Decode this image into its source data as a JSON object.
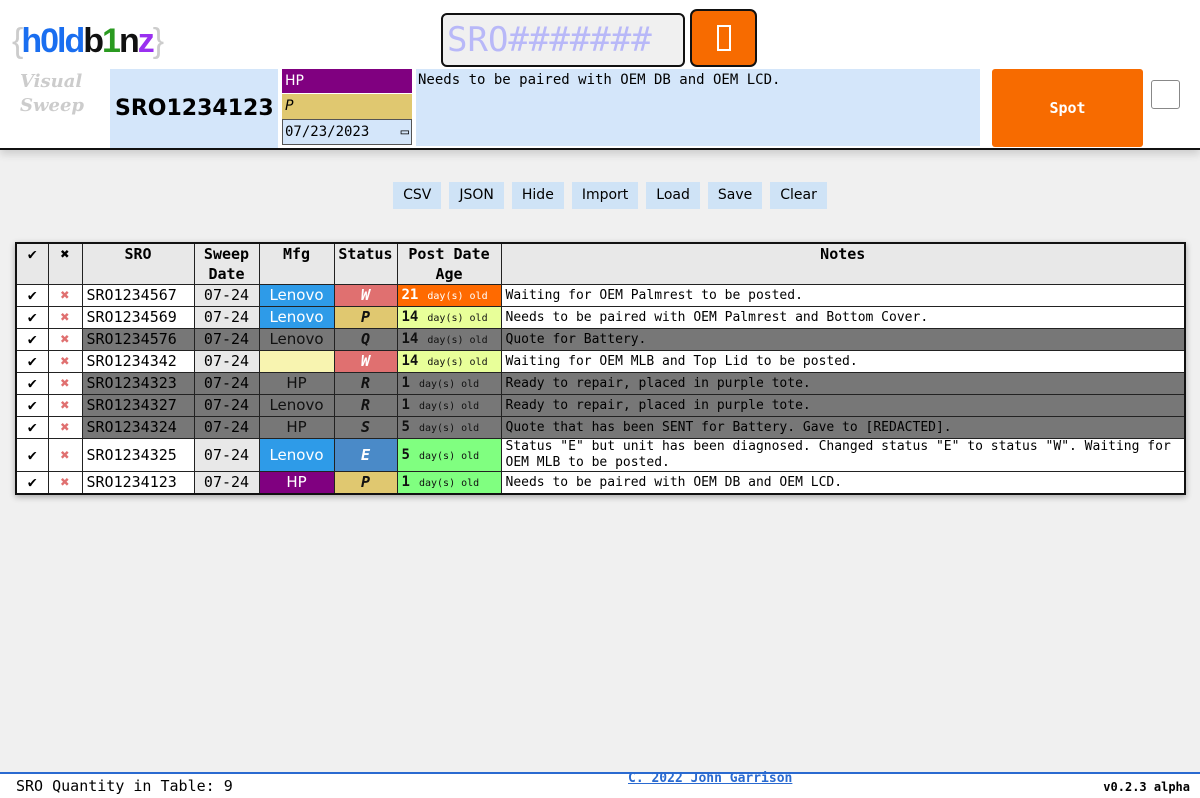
{
  "header": {
    "logo": {
      "brace_open": "{",
      "parts": [
        "h0ld",
        "b",
        "1",
        "n",
        "z"
      ],
      "brace_close": "}"
    },
    "subtitle_line1": "Visual",
    "subtitle_line2": "Sweep",
    "search_placeholder": "SRO#######",
    "search_icon": "box-icon",
    "sro": "SRO1234123",
    "mfg": "HP",
    "status": "P",
    "date": "07/23/2023",
    "notes": "Needs to be paired with OEM DB and OEM LCD.",
    "spot_label": "Spot"
  },
  "toolbar": [
    "CSV",
    "JSON",
    "Hide",
    "Import",
    "Load",
    "Save",
    "Clear"
  ],
  "table": {
    "headers": [
      "✔",
      "✖",
      "SRO",
      "Sweep Date",
      "Mfg",
      "Status",
      "Post Date Age",
      "Notes"
    ],
    "rows": [
      {
        "check": "✔",
        "del": "✖",
        "sro": "SRO1234567",
        "date": "07-24",
        "mfg": "Lenovo",
        "status": "W",
        "age": "21",
        "age_unit": "day(s) old",
        "notes": "Waiting for OEM Palmrest to be posted."
      },
      {
        "check": "✔",
        "del": "✖",
        "sro": "SRO1234569",
        "date": "07-24",
        "mfg": "Lenovo",
        "status": "P",
        "age": "14",
        "age_unit": "day(s) old",
        "notes": "Needs to be paired with OEM Palmrest and Bottom Cover."
      },
      {
        "check": "✔",
        "del": "✖",
        "sro": "SRO1234576",
        "date": "07-24",
        "mfg": "Lenovo",
        "status": "Q",
        "age": "14",
        "age_unit": "day(s) old",
        "notes": "Quote for Battery."
      },
      {
        "check": "✔",
        "del": "✖",
        "sro": "SRO1234342",
        "date": "07-24",
        "mfg": "",
        "status": "W",
        "age": "14",
        "age_unit": "day(s) old",
        "notes": "Waiting for OEM MLB and Top Lid to be posted."
      },
      {
        "check": "✔",
        "del": "✖",
        "sro": "SRO1234323",
        "date": "07-24",
        "mfg": "HP",
        "status": "R",
        "age": "1",
        "age_unit": "day(s) old",
        "notes": "Ready to repair, placed in purple tote."
      },
      {
        "check": "✔",
        "del": "✖",
        "sro": "SRO1234327",
        "date": "07-24",
        "mfg": "Lenovo",
        "status": "R",
        "age": "1",
        "age_unit": "day(s) old",
        "notes": "Ready to repair, placed in purple tote."
      },
      {
        "check": "✔",
        "del": "✖",
        "sro": "SRO1234324",
        "date": "07-24",
        "mfg": "HP",
        "status": "S",
        "age": "5",
        "age_unit": "day(s) old",
        "notes": "Quote that has been SENT for Battery. Gave to [REDACTED]."
      },
      {
        "check": "✔",
        "del": "✖",
        "sro": "SRO1234325",
        "date": "07-24",
        "mfg": "Lenovo",
        "status": "E",
        "age": "5",
        "age_unit": "day(s) old",
        "notes": "Status \"E\" but unit has been diagnosed. Changed status \"E\" to status \"W\". Waiting for OEM MLB to be posted."
      },
      {
        "check": "✔",
        "del": "✖",
        "sro": "SRO1234123",
        "date": "07-24",
        "mfg": "HP",
        "status": "P",
        "age": "1",
        "age_unit": "day(s) old",
        "notes": "Needs to be paired with OEM DB and OEM LCD."
      }
    ]
  },
  "colors": {
    "accent": "#f76b00",
    "lenovo": "#2e9be8",
    "hp": "#800080",
    "status_W": "#e07070",
    "status_P": "#e0c870",
    "status_E": "#4a8ac8",
    "gray": "#777777",
    "age_old": "#ff6a00",
    "age_mid": "#e8ff99",
    "age_new": "#80ff80"
  },
  "footer": {
    "quantity": "SRO Quantity in Table: 9",
    "copyright": "C. 2022 John Garrison",
    "version": "v0.2.3 alpha"
  }
}
